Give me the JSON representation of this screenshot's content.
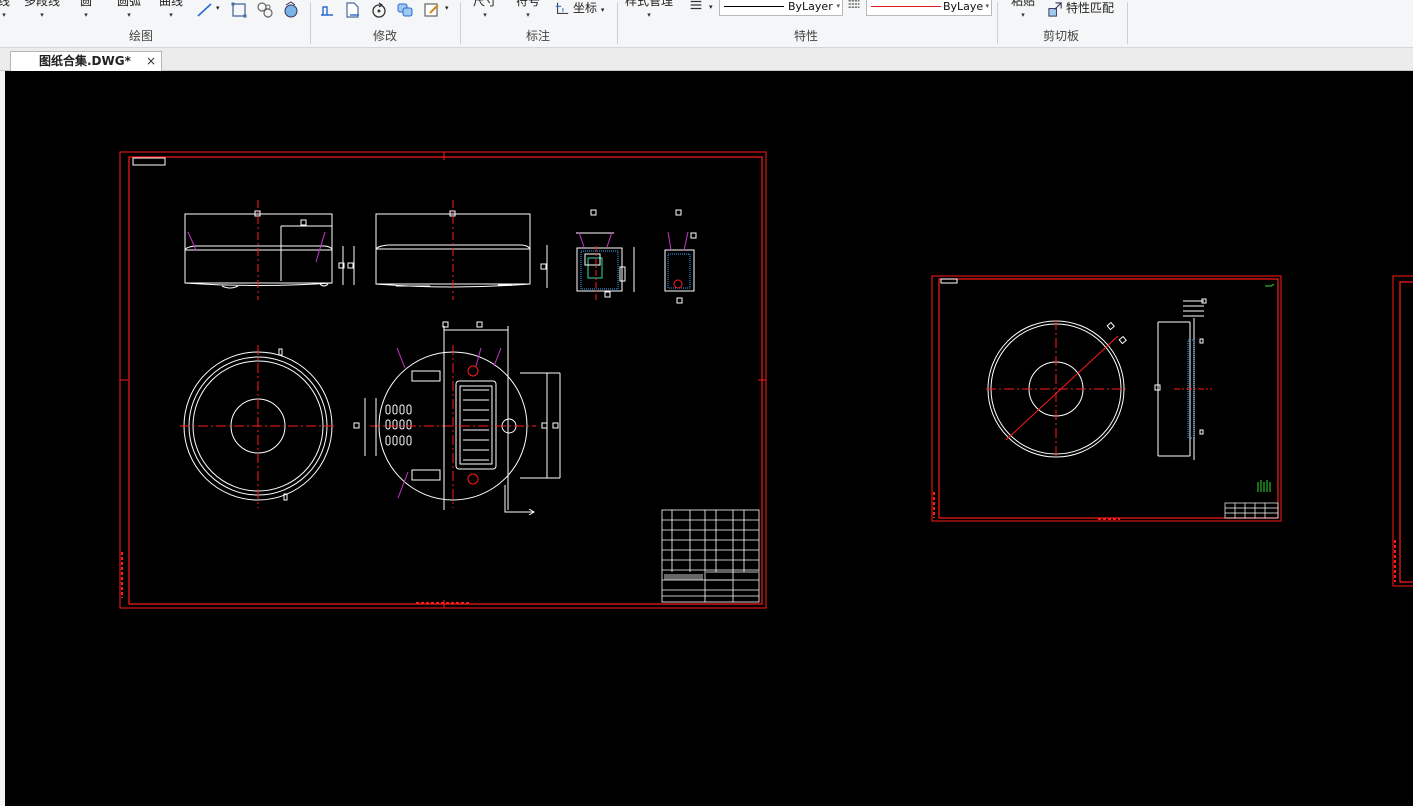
{
  "ribbon": {
    "groups": [
      {
        "label": "绘图",
        "buttons": [
          {
            "label": "线"
          },
          {
            "label": "多段线"
          },
          {
            "label": "圆"
          },
          {
            "label": "圆弧"
          },
          {
            "label": "曲线"
          }
        ]
      },
      {
        "label": "修改"
      },
      {
        "label": "标注",
        "buttons": [
          {
            "label": "尺寸"
          },
          {
            "label": "符号"
          },
          {
            "label": "坐标"
          }
        ]
      },
      {
        "label": "特性",
        "buttons": [
          {
            "label": "样式管理"
          }
        ],
        "color_combo": "ByLayer",
        "linetype_combo": "ByLaye"
      },
      {
        "label": "剪切板",
        "buttons": [
          {
            "label": "粘贴"
          },
          {
            "label": "特性匹配"
          }
        ]
      }
    ]
  },
  "document": {
    "tab_title": "图纸合集.DWG*",
    "close_glyph": "×"
  },
  "colors": {
    "canvas_bg": "#000000",
    "frame_red": "#ff1a1a",
    "geometry_white": "#ffffff",
    "leader_magenta": "#cc33cc",
    "accent_green": "#33dd33"
  }
}
